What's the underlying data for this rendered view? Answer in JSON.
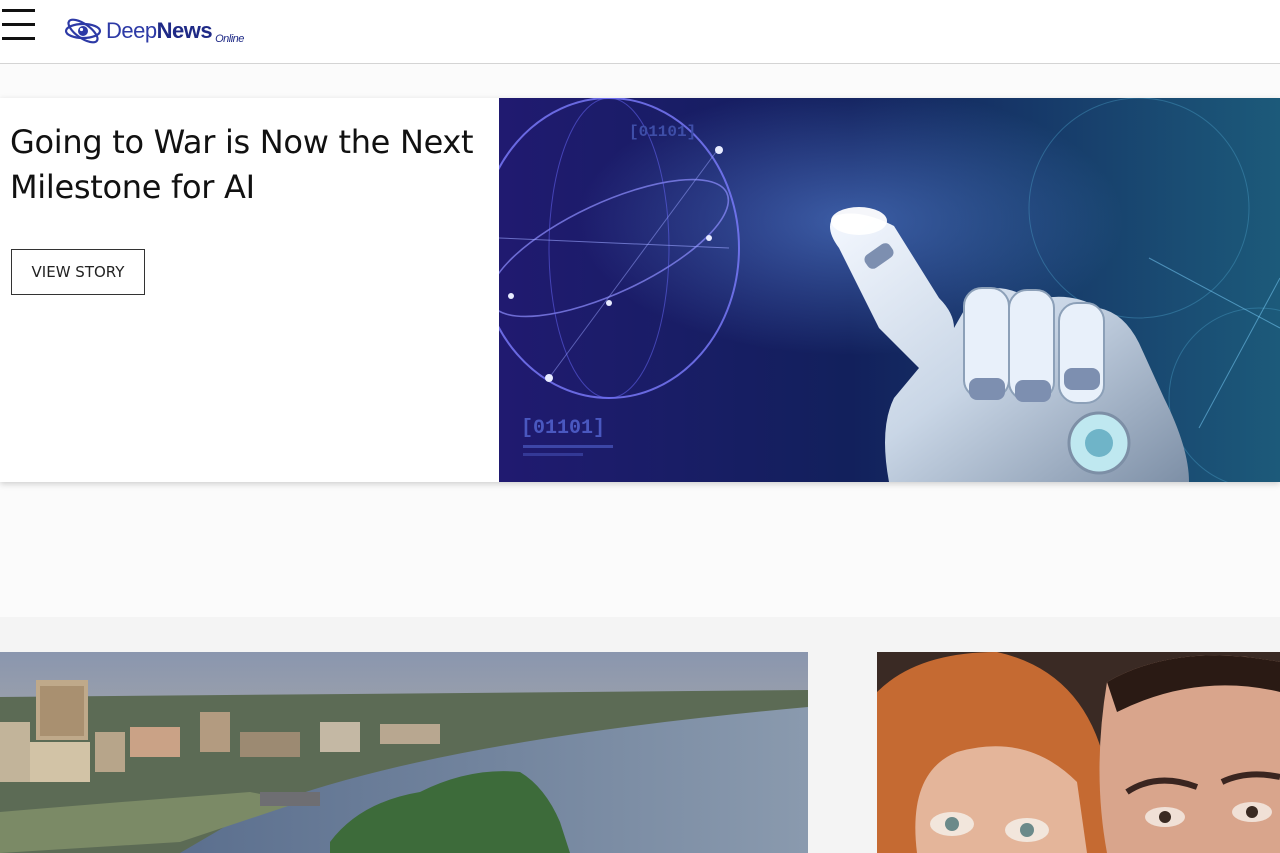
{
  "header": {
    "menu_icon": "hamburger-icon",
    "logo": {
      "deep": "Deep",
      "news": "News",
      "online": "Online"
    }
  },
  "hero": {
    "title": "Going to War is Now the Next Milestone for AI",
    "button_label": "VIEW STORY",
    "image_text_1": "[01101]",
    "image_text_2": "[01101]"
  },
  "colors": {
    "brand": "#2d3aa6",
    "hero_bg": "#0f1a52",
    "accent_glow": "#8fb4ff"
  }
}
